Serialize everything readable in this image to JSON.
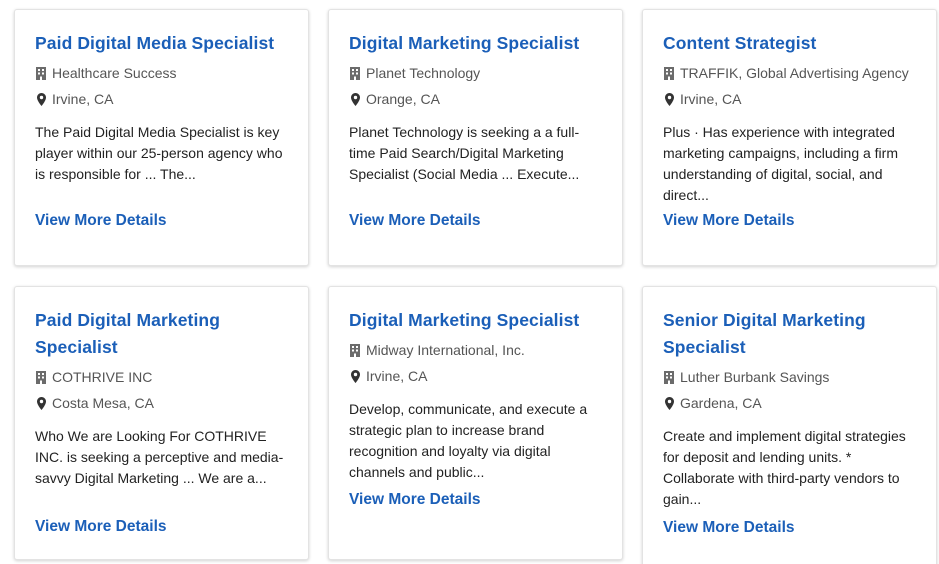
{
  "jobs": [
    {
      "title": "Paid Digital Media Specialist",
      "company": "Healthcare Success",
      "location": "Irvine, CA",
      "description": "The Paid Digital Media Specialist is key player within our 25-person agency who is responsible for ... The...",
      "link": "View More Details"
    },
    {
      "title": "Digital Marketing Specialist",
      "company": "Planet Technology",
      "location": "Orange, CA",
      "description": "Planet Technology is seeking a a full-time Paid Search/Digital Marketing Specialist (Social Media ... Execute...",
      "link": "View More Details"
    },
    {
      "title": "Content Strategist",
      "company": "TRAFFIK, Global Advertising Agency",
      "location": "Irvine, CA",
      "description": "Plus · Has experience with integrated marketing campaigns, including a firm understanding of digital, social, and direct...",
      "link": "View More Details"
    },
    {
      "title": "Paid Digital Marketing Specialist",
      "company": "COTHRIVE INC",
      "location": "Costa Mesa, CA",
      "description": "Who We are Looking For COTHRIVE INC. is seeking a perceptive and media-savvy Digital Marketing ... We are a...",
      "link": "View More Details"
    },
    {
      "title": "Digital Marketing Specialist",
      "company": "Midway International, Inc.",
      "location": "Irvine, CA",
      "description": "Develop, communicate, and execute a strategic plan to increase brand recognition and loyalty via digital channels and public...",
      "link": "View More Details"
    },
    {
      "title": "Senior Digital Marketing Specialist",
      "company": "Luther Burbank Savings",
      "location": "Gardena, CA",
      "description": "Create and implement digital strategies for deposit and lending units. * Collaborate with third-party vendors to gain...",
      "link": "View More Details"
    }
  ],
  "icons": {
    "company": "building-icon",
    "location": "map-pin-icon"
  },
  "colors": {
    "link": "#1b5fb8",
    "meta_text": "#555555",
    "body_text": "#222222",
    "card_border": "#e3e3e3"
  }
}
